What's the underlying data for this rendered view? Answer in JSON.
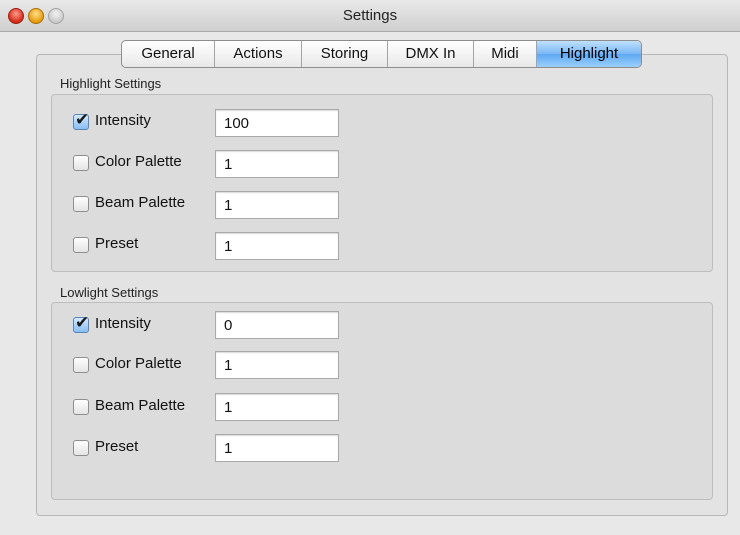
{
  "window": {
    "title": "Settings"
  },
  "tabs": [
    {
      "label": "General",
      "selected": false
    },
    {
      "label": "Actions",
      "selected": false
    },
    {
      "label": "Storing",
      "selected": false
    },
    {
      "label": "DMX In",
      "selected": false
    },
    {
      "label": "Midi",
      "selected": false
    },
    {
      "label": "Highlight",
      "selected": true
    }
  ],
  "highlight": {
    "title": "Highlight Settings",
    "rows": [
      {
        "label": "Intensity",
        "checked": true,
        "value": "100"
      },
      {
        "label": "Color Palette",
        "checked": false,
        "value": "1"
      },
      {
        "label": "Beam Palette",
        "checked": false,
        "value": "1"
      },
      {
        "label": "Preset",
        "checked": false,
        "value": "1"
      }
    ]
  },
  "lowlight": {
    "title": "Lowlight Settings",
    "rows": [
      {
        "label": "Intensity",
        "checked": true,
        "value": "0"
      },
      {
        "label": "Color Palette",
        "checked": false,
        "value": "1"
      },
      {
        "label": "Beam Palette",
        "checked": false,
        "value": "1"
      },
      {
        "label": "Preset",
        "checked": false,
        "value": "1"
      }
    ]
  }
}
